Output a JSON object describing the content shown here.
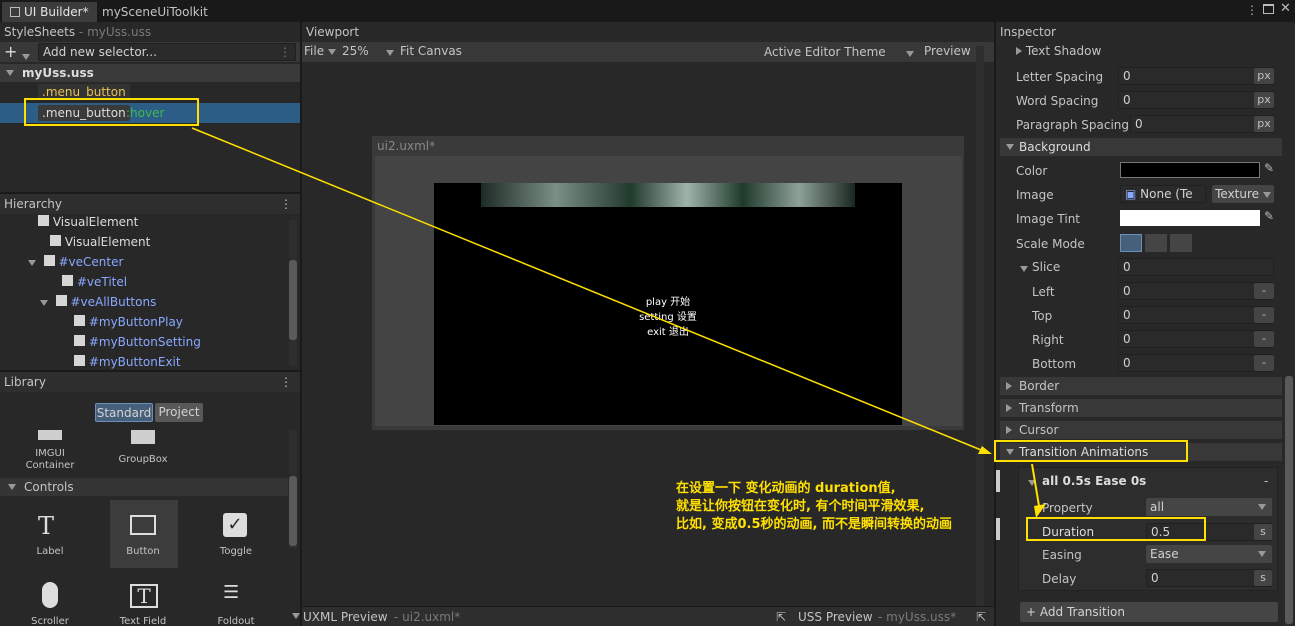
{
  "tabs": [
    {
      "label": "UI Builder*"
    },
    {
      "label": "mySceneUiToolkit"
    }
  ],
  "stylesheets": {
    "title": "StyleSheets",
    "file": "- myUss.uss",
    "selector_placeholder": "Add new selector...",
    "sheet_name": "myUss.uss",
    "selectors": [
      {
        "name": ".menu_button",
        "pseudo": ""
      },
      {
        "name": ".menu_button",
        "pseudo": ":hover"
      }
    ]
  },
  "hierarchy": {
    "title": "Hierarchy",
    "items": [
      {
        "label": "VisualElement"
      },
      {
        "label": "VisualElement"
      },
      {
        "label": "#veCenter"
      },
      {
        "label": "#veTitel"
      },
      {
        "label": "#veAllButtons"
      },
      {
        "label": "#myButtonPlay"
      },
      {
        "label": "#myButtonSetting"
      },
      {
        "label": "#myButtonExit"
      }
    ]
  },
  "library": {
    "title": "Library",
    "tabs": [
      "Standard",
      "Project"
    ],
    "top_items": [
      "IMGUI\nContainer",
      "GroupBox"
    ],
    "section": "Controls",
    "controls": [
      "Label",
      "Button",
      "Toggle",
      "Scroller",
      "Text Field",
      "Foldout"
    ]
  },
  "viewport": {
    "title": "Viewport",
    "file_menu": "File",
    "zoom": "25%",
    "fit": "Fit Canvas",
    "theme": "Active Editor Theme",
    "preview": "Preview",
    "doc_name": "ui2.uxml*",
    "menu_lines": [
      "play 开始",
      "setting 设置",
      "exit 退出"
    ],
    "uxml_preview": "UXML Preview",
    "uxml_file": "- ui2.uxml*",
    "uss_preview": "USS Preview",
    "uss_file": "- myUss.uss*"
  },
  "inspector": {
    "title": "Inspector",
    "text_shadow": "Text Shadow",
    "letter_spacing": {
      "label": "Letter Spacing",
      "value": "0",
      "unit": "px"
    },
    "word_spacing": {
      "label": "Word Spacing",
      "value": "0",
      "unit": "px"
    },
    "paragraph_spacing": {
      "label": "Paragraph Spacing",
      "value": "0",
      "unit": "px"
    },
    "background": "Background",
    "color_label": "Color",
    "image_label": "Image",
    "image_value": "None (Te",
    "image_type": "Texture",
    "image_tint": "Image Tint",
    "scale_mode": "Scale Mode",
    "slice": {
      "label": "Slice",
      "value": "0"
    },
    "slice_left": {
      "label": "Left",
      "value": "0"
    },
    "slice_top": {
      "label": "Top",
      "value": "0"
    },
    "slice_right": {
      "label": "Right",
      "value": "0"
    },
    "slice_bottom": {
      "label": "Bottom",
      "value": "0"
    },
    "border": "Border",
    "transform": "Transform",
    "cursor": "Cursor",
    "transition_animations": "Transition Animations",
    "transition_header": "all 0.5s Ease 0s",
    "property": {
      "label": "Property",
      "value": "all"
    },
    "duration": {
      "label": "Duration",
      "value": "0.5",
      "unit": "s"
    },
    "easing": {
      "label": "Easing",
      "value": "Ease"
    },
    "delay": {
      "label": "Delay",
      "value": "0",
      "unit": "s"
    },
    "add_transition": "Add Transition",
    "minus": "-"
  },
  "annotation": {
    "lines": [
      "在设置一下 变化动画的 duration值,",
      "就是让你按钮在变化时, 有个时间平滑效果,",
      "比如, 变成0.5秒的动画, 而不是瞬间转换的动画"
    ]
  },
  "colors": {
    "accent": "#ffe000",
    "selection": "#2c5d87",
    "link": "#8aa8ff"
  }
}
